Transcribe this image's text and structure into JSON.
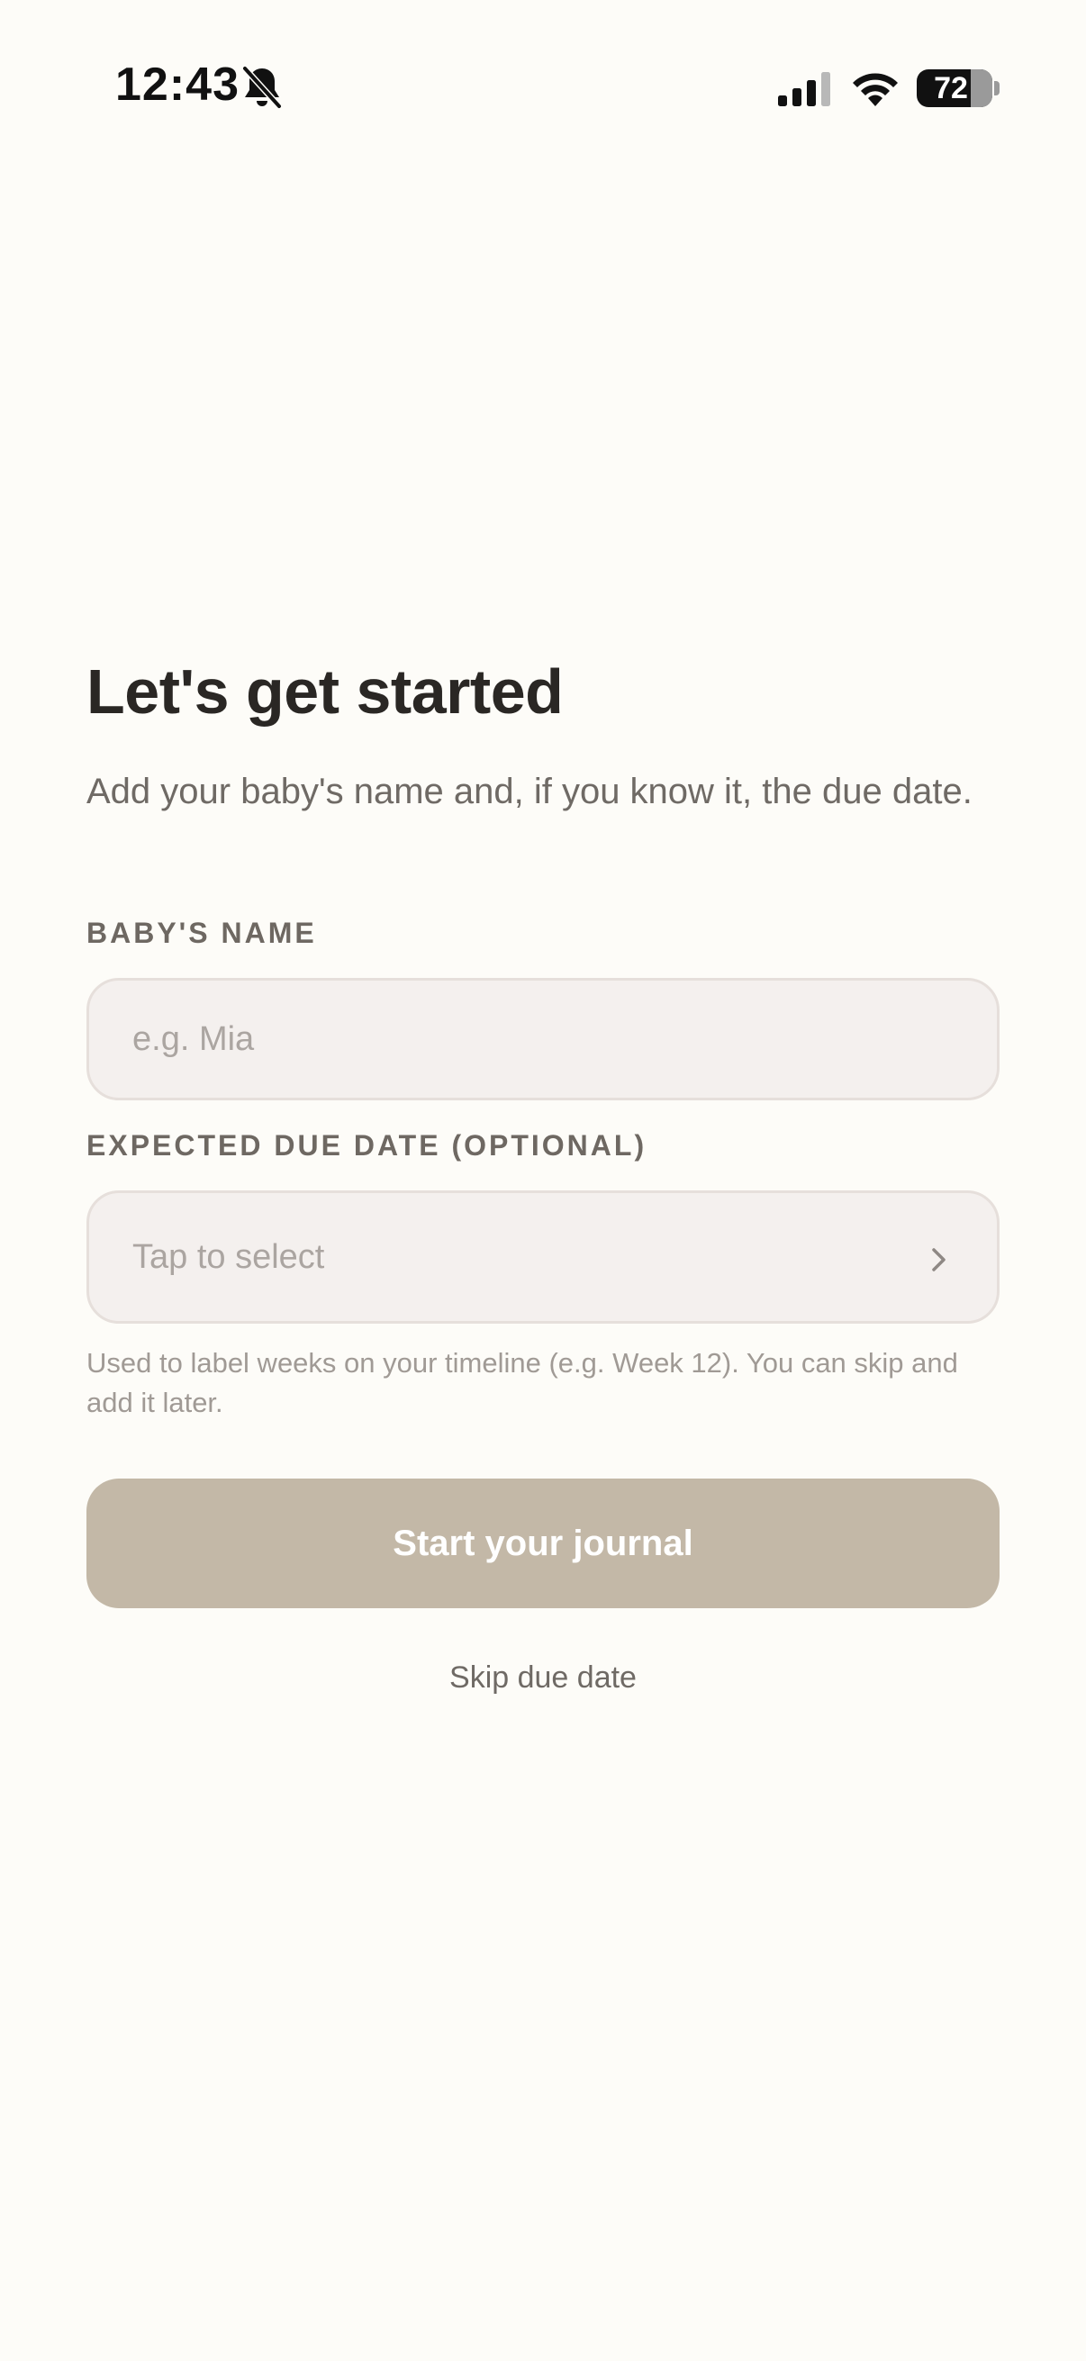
{
  "status_bar": {
    "time": "12:43",
    "battery_percent": "72",
    "battery_level": 0.72,
    "icons": [
      "bell-off-icon",
      "cellular-signal-icon",
      "wifi-icon",
      "battery-icon"
    ]
  },
  "onboarding": {
    "title": "Let's get started",
    "subtitle": "Add your baby's name and, if you know it, the due date.",
    "name_field": {
      "label": "BABY'S NAME",
      "placeholder": "e.g. Mia",
      "value": ""
    },
    "due_date_field": {
      "label": "EXPECTED DUE DATE (OPTIONAL)",
      "placeholder": "Tap to select",
      "helper": "Used to label weeks on your timeline (e.g. Week 12). You can skip and add it later."
    },
    "primary_button_label": "Start your journal",
    "skip_label": "Skip due date"
  },
  "colors": {
    "background": "#FDFCF8",
    "field_background": "#F4F0EE",
    "field_border": "#E6DFDB",
    "primary_button": "#C3B8A7",
    "title_text": "#2A2724"
  }
}
